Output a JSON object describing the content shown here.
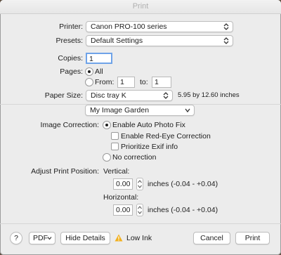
{
  "window": {
    "title": "Print"
  },
  "printer": {
    "label": "Printer:",
    "value": "Canon PRO-100 series"
  },
  "presets": {
    "label": "Presets:",
    "value": "Default Settings"
  },
  "copies": {
    "label": "Copies:",
    "value": "1"
  },
  "pages": {
    "label": "Pages:",
    "all_label": "All",
    "from_label": "From:",
    "from_value": "1",
    "to_label": "to:",
    "to_value": "1"
  },
  "paper_size": {
    "label": "Paper Size:",
    "value": "Disc tray K",
    "dimensions": "5.95 by 12.60 inches"
  },
  "panel_menu": {
    "value": "My Image Garden"
  },
  "image_correction": {
    "label": "Image Correction:",
    "auto_fix_label": "Enable Auto Photo Fix",
    "red_eye_label": "Enable Red-Eye Correction",
    "exif_label": "Prioritize Exif info",
    "no_correction_label": "No correction"
  },
  "adjust": {
    "label": "Adjust Print Position:",
    "vertical_label": "Vertical:",
    "vertical_value": "0.00",
    "vertical_units": "inches (-0.04 - +0.04)",
    "horizontal_label": "Horizontal:",
    "horizontal_value": "0.00",
    "horizontal_units": "inches (-0.04 - +0.04)"
  },
  "footer": {
    "help_label": "?",
    "pdf_label": "PDF",
    "hide_details_label": "Hide Details",
    "low_ink_label": "Low Ink",
    "cancel_label": "Cancel",
    "print_label": "Print"
  },
  "colors": {
    "warning": "#f2b01e",
    "window_bg": "#ececec"
  }
}
